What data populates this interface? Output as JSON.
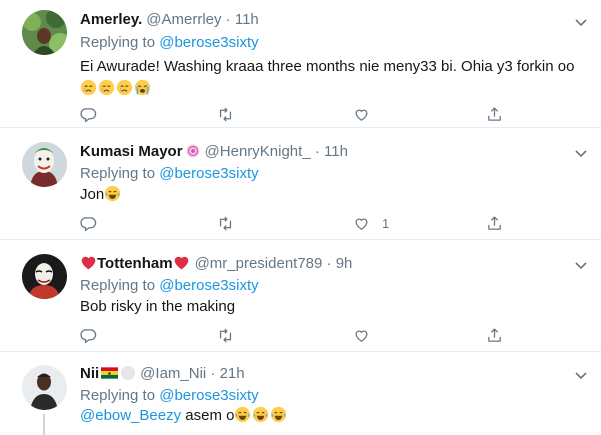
{
  "tweets": [
    {
      "name": "Amerley.",
      "handle": "@Amerrley",
      "time": "· 11h",
      "replying_prefix": "Replying to ",
      "replying_to": "@berose3sixty",
      "text": "Ei Awurade! Washing kraaa three months nie meny33 bi. Ohia y3 forkin oo",
      "emojis": [
        "crying-face",
        "crying-face",
        "crying-face",
        "loudly-crying-face"
      ],
      "likes": ""
    },
    {
      "name": "Kumasi Mayor",
      "handle": "@HenryKnight_",
      "time": "· 11h",
      "replying_prefix": "Replying to ",
      "replying_to": "@berose3sixty",
      "text": "Jon",
      "emojis": [
        "tears-of-joy"
      ],
      "likes": "1"
    },
    {
      "name": "Tottenham",
      "handle": "@mr_president789",
      "time": "· 9h",
      "replying_prefix": "Replying to ",
      "replying_to": "@berose3sixty",
      "text": "Bob risky in the making",
      "likes": ""
    },
    {
      "name": "Nii",
      "handle": "@Iam_Nii",
      "time": "· 21h",
      "replying_prefix": "Replying to ",
      "replying_to": "@berose3sixty",
      "mention": "@ebow_Beezy",
      "text": " asem o",
      "emojis": [
        "tears-of-joy",
        "tears-of-joy",
        "tears-of-joy"
      ]
    }
  ],
  "colors": {
    "link": "#1b95e0",
    "muted": "#657786",
    "text": "#14171a",
    "divider": "#e6ecf0"
  }
}
